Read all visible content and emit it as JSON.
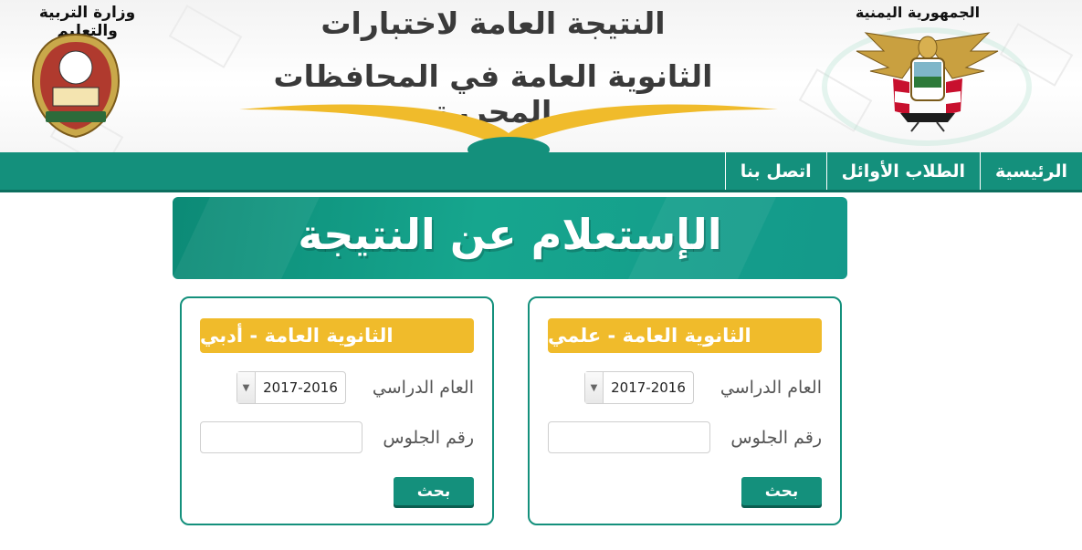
{
  "header": {
    "ministry_name": "وزارة التربية والتعليم",
    "republic_name": "الجمهورية اليمنية",
    "title_line1": "النتيجة العامة لاختبارات",
    "title_line2": "الثانوية العامة في المحافظات المحررة",
    "ministry_logo_icon": "ministry-seal-icon",
    "emblem_icon": "yemen-eagle-emblem-icon",
    "book_icon": "open-book-icon"
  },
  "nav": {
    "items": [
      {
        "label": "الرئيسية"
      },
      {
        "label": "الطلاب الأوائل"
      },
      {
        "label": "اتصل بنا"
      }
    ]
  },
  "banner": {
    "text": "الإستعلام عن النتيجة"
  },
  "cards": {
    "scientific": {
      "title": "الثانوية العامة - علمي",
      "year_label": "العام الدراسي",
      "year_value": "2017-2016",
      "seat_label": "رقم الجلوس",
      "seat_value": "",
      "button": "بحث"
    },
    "literary": {
      "title": "الثانوية العامة - أدبي",
      "year_label": "العام الدراسي",
      "year_value": "2017-2016",
      "seat_label": "رقم الجلوس",
      "seat_value": "",
      "button": "بحث"
    }
  },
  "colors": {
    "primary": "#14907c",
    "accent": "#f0bb2b"
  }
}
